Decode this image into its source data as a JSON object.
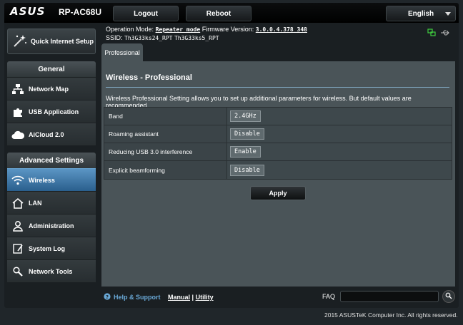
{
  "header": {
    "brand": "ASUS",
    "model": "RP-AC68U",
    "logout_label": "Logout",
    "reboot_label": "Reboot",
    "language": "English"
  },
  "info": {
    "operation_mode_label": "Operation Mode:",
    "operation_mode_value": "Repeater mode",
    "firmware_label": "Firmware Version:",
    "firmware_value": "3.0.0.4.378_348",
    "ssid_label": "SSID:",
    "ssid_1": "Th3G33ks24_RPT",
    "ssid_2": "Th3G33ks5_RPT"
  },
  "sidebar": {
    "quick_setup": "Quick Internet Setup",
    "general_title": "General",
    "general_items": [
      {
        "label": "Network Map",
        "icon": "network-map-icon"
      },
      {
        "label": "USB Application",
        "icon": "puzzle-icon"
      },
      {
        "label": "AiCloud 2.0",
        "icon": "cloud-icon"
      }
    ],
    "advanced_title": "Advanced Settings",
    "advanced_items": [
      {
        "label": "Wireless",
        "icon": "wifi-icon",
        "active": true
      },
      {
        "label": "LAN",
        "icon": "home-icon"
      },
      {
        "label": "Administration",
        "icon": "user-icon"
      },
      {
        "label": "System Log",
        "icon": "log-icon"
      },
      {
        "label": "Network Tools",
        "icon": "tools-icon"
      }
    ]
  },
  "main": {
    "tab_label": "Professional",
    "title": "Wireless - Professional",
    "description": "Wireless Professional Setting allows you to set up additional parameters for wireless. But default values are recommended.",
    "settings": [
      {
        "label": "Band",
        "value": "2.4GHz"
      },
      {
        "label": "Roaming assistant",
        "value": "Disable"
      },
      {
        "label": "Reducing USB 3.0 interference",
        "value": "Enable"
      },
      {
        "label": "Explicit beamforming",
        "value": "Disable"
      }
    ],
    "apply_label": "Apply"
  },
  "footer": {
    "help_label": "Help & Support",
    "manual_label": "Manual",
    "separator": "|",
    "utility_label": "Utility",
    "faq_label": "FAQ",
    "faq_placeholder": "",
    "copyright": "2015 ASUSTeK Computer Inc. All rights reserved."
  },
  "colors": {
    "accent": "#2a5f8d",
    "link": "#69a8d6",
    "panel": "#4a5458"
  }
}
